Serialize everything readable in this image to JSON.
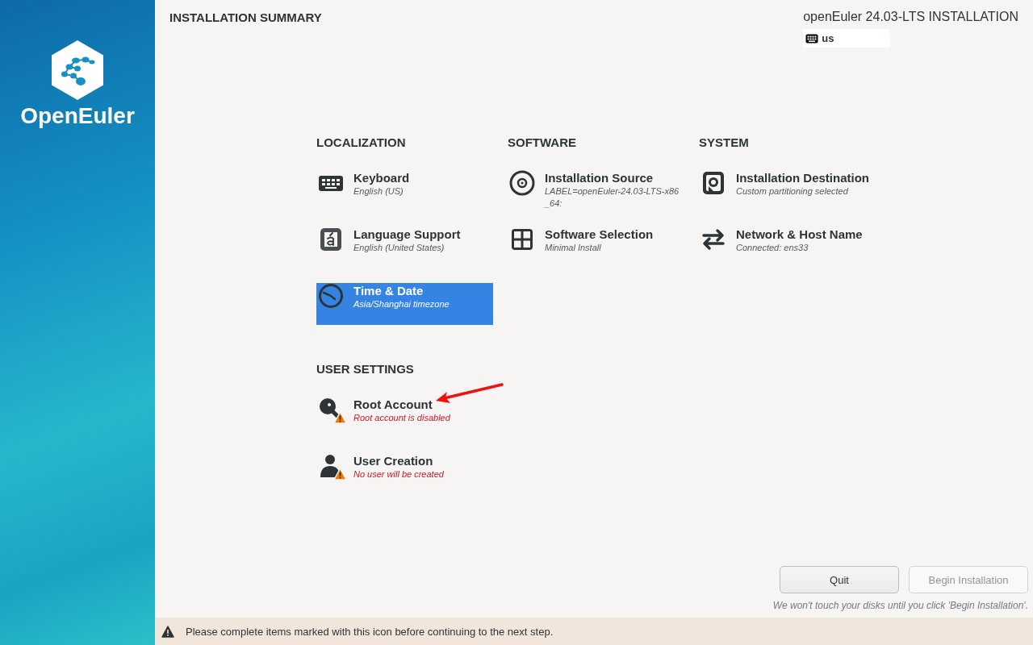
{
  "sidebar": {
    "logo_text": "OpenEuler"
  },
  "header": {
    "title": "INSTALLATION SUMMARY",
    "product": "openEuler 24.03-LTS INSTALLATION",
    "keyboard_layout": "us"
  },
  "categories": [
    {
      "title": "LOCALIZATION",
      "spokes": [
        {
          "kind": "keyboard",
          "title": "Keyboard",
          "status": "English (US)",
          "warning": false,
          "selected": false
        },
        {
          "kind": "language",
          "title": "Language Support",
          "status": "English (United States)",
          "warning": false,
          "selected": false
        },
        {
          "kind": "clock",
          "title": "Time & Date",
          "status": "Asia/Shanghai timezone",
          "warning": false,
          "selected": true
        }
      ]
    },
    {
      "title": "SOFTWARE",
      "spokes": [
        {
          "kind": "disc",
          "title": "Installation Source",
          "status": "LABEL=openEuler-24.03-LTS-x86_64:",
          "warning": false,
          "selected": false
        },
        {
          "kind": "package",
          "title": "Software Selection",
          "status": "Minimal Install",
          "warning": false,
          "selected": false
        }
      ]
    },
    {
      "title": "SYSTEM",
      "spokes": [
        {
          "kind": "drive",
          "title": "Installation Destination",
          "status": "Custom partitioning selected",
          "warning": false,
          "selected": false
        },
        {
          "kind": "network",
          "title": "Network & Host Name",
          "status": "Connected: ens33",
          "warning": false,
          "selected": false
        }
      ]
    },
    {
      "title": "USER SETTINGS",
      "spokes": [
        {
          "kind": "key",
          "title": "Root Account",
          "status": "Root account is disabled",
          "warning": true,
          "selected": false
        },
        {
          "kind": "user",
          "title": "User Creation",
          "status": "No user will be created",
          "warning": true,
          "selected": false
        }
      ]
    }
  ],
  "buttons": [
    {
      "label": "Quit",
      "disabled": false
    },
    {
      "label": "Begin Installation",
      "disabled": true
    }
  ],
  "hint": "We won't touch your disks until you click 'Begin Installation'.",
  "warning_bar": {
    "text": "Please complete items marked with this icon before continuing to the next step."
  }
}
